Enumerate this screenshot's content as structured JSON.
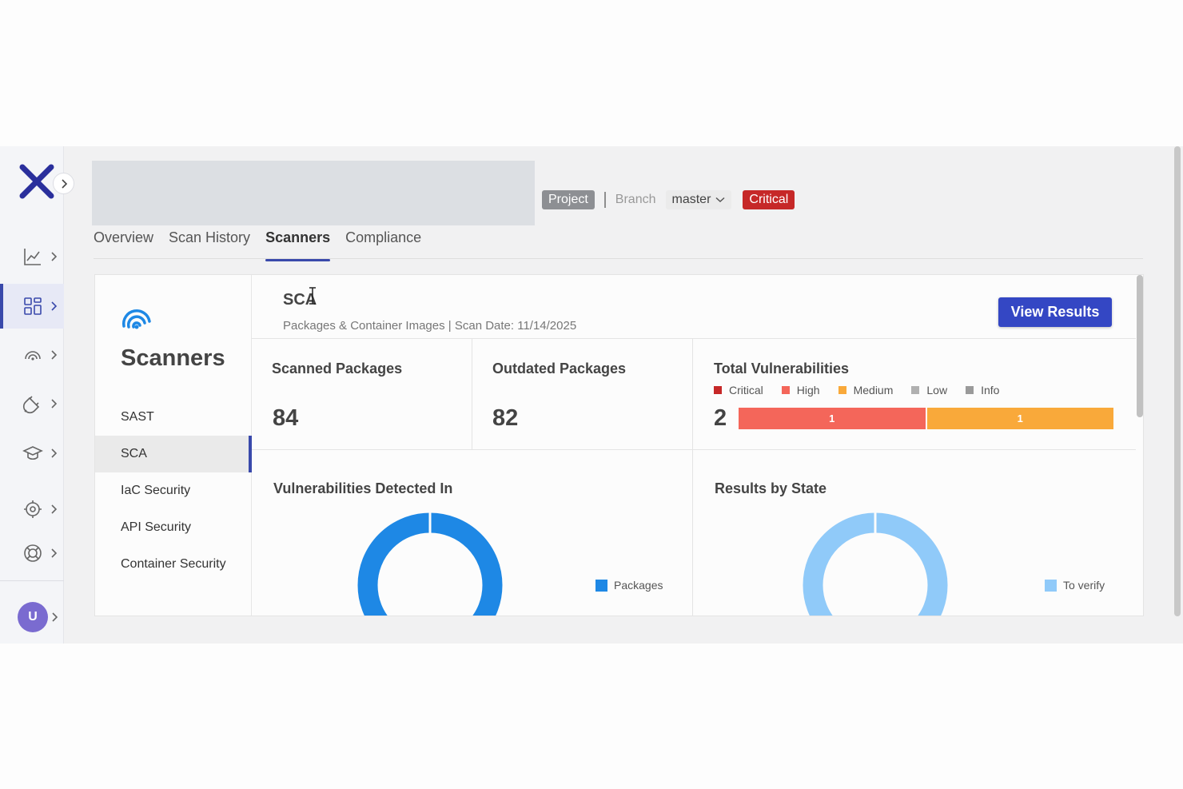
{
  "header": {
    "project_tag": "Project",
    "branch_label": "Branch",
    "branch_value": "master",
    "risk_tag": "Critical"
  },
  "tabs": [
    {
      "label": "Overview"
    },
    {
      "label": "Scan History"
    },
    {
      "label": "Scanners"
    },
    {
      "label": "Compliance"
    }
  ],
  "sidebar": {
    "title": "Scanners",
    "items": [
      {
        "label": "SAST"
      },
      {
        "label": "SCA"
      },
      {
        "label": "IaC Security"
      },
      {
        "label": "API Security"
      },
      {
        "label": "Container Security"
      }
    ],
    "active_item": "SCA"
  },
  "user": {
    "initial": "U"
  },
  "scanner": {
    "title": "SCA",
    "subtitle": "Packages & Container Images | Scan Date: 11/14/2025",
    "view_button": "View Results"
  },
  "stats": {
    "scanned_label": "Scanned Packages",
    "scanned_value": "84",
    "outdated_label": "Outdated Packages",
    "outdated_value": "82",
    "vuln_label": "Total Vulnerabilities",
    "vuln_total": "2",
    "legend": [
      {
        "label": "Critical",
        "color": "#c62828"
      },
      {
        "label": "High",
        "color": "#f4665a"
      },
      {
        "label": "Medium",
        "color": "#f9a93a"
      },
      {
        "label": "Low",
        "color": "#b0b0b0"
      },
      {
        "label": "Info",
        "color": "#9a9a9a"
      }
    ],
    "segments": [
      {
        "label": "1",
        "severity": "High",
        "value": 1,
        "color": "#f4665a"
      },
      {
        "label": "1",
        "severity": "Medium",
        "value": 1,
        "color": "#f9a93a"
      }
    ]
  },
  "sections": {
    "detected_title": "Vulnerabilities Detected In",
    "detected_legend": "Packages",
    "detected_color": "#1e88e5",
    "state_title": "Results by State",
    "state_legend": "To verify",
    "state_color": "#90caf9"
  },
  "colors": {
    "accent": "#3949ab",
    "button": "#3447c4"
  }
}
